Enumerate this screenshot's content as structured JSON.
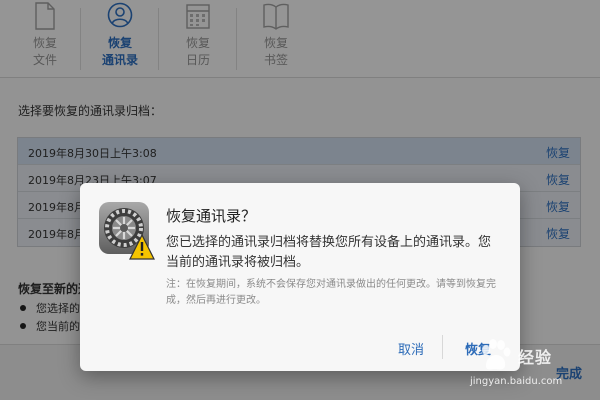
{
  "toolbar": {
    "items": [
      {
        "line1": "恢复",
        "line2": "文件",
        "icon": "document-icon"
      },
      {
        "line1": "恢复",
        "line2": "通讯录",
        "icon": "contacts-icon"
      },
      {
        "line1": "恢复",
        "line2": "日历",
        "icon": "calendar-icon"
      },
      {
        "line1": "恢复",
        "line2": "书签",
        "icon": "bookmarks-icon"
      }
    ],
    "active_index": 1
  },
  "main": {
    "prompt": "选择要恢复的通讯录归档：",
    "archives": [
      {
        "date": "2019年8月30日上午3:08",
        "action": "恢复"
      },
      {
        "date": "2019年8月23日上午3:07",
        "action": "恢复"
      },
      {
        "date": "2019年8月",
        "action": "恢复"
      },
      {
        "date": "2019年8月",
        "action": "恢复"
      }
    ],
    "note_title": "恢复至新的通",
    "bullets": [
      "您选择的",
      "您当前的"
    ],
    "done": "完成"
  },
  "dialog": {
    "title": "恢复通讯录？",
    "message": "您已选择的通讯录归档将替换您所有设备上的通讯录。您当前的通讯录将被归档。",
    "note": "注：在恢复期间，系统不会保存您对通讯录做出的任何更改。请等到恢复完成，然后再进行更改。",
    "cancel": "取消",
    "confirm": "恢复"
  },
  "watermark": {
    "text": "经验",
    "url": "jingyan.baidu.com"
  },
  "colors": {
    "accent": "#2c6bb8",
    "warning": "#f5c400"
  }
}
